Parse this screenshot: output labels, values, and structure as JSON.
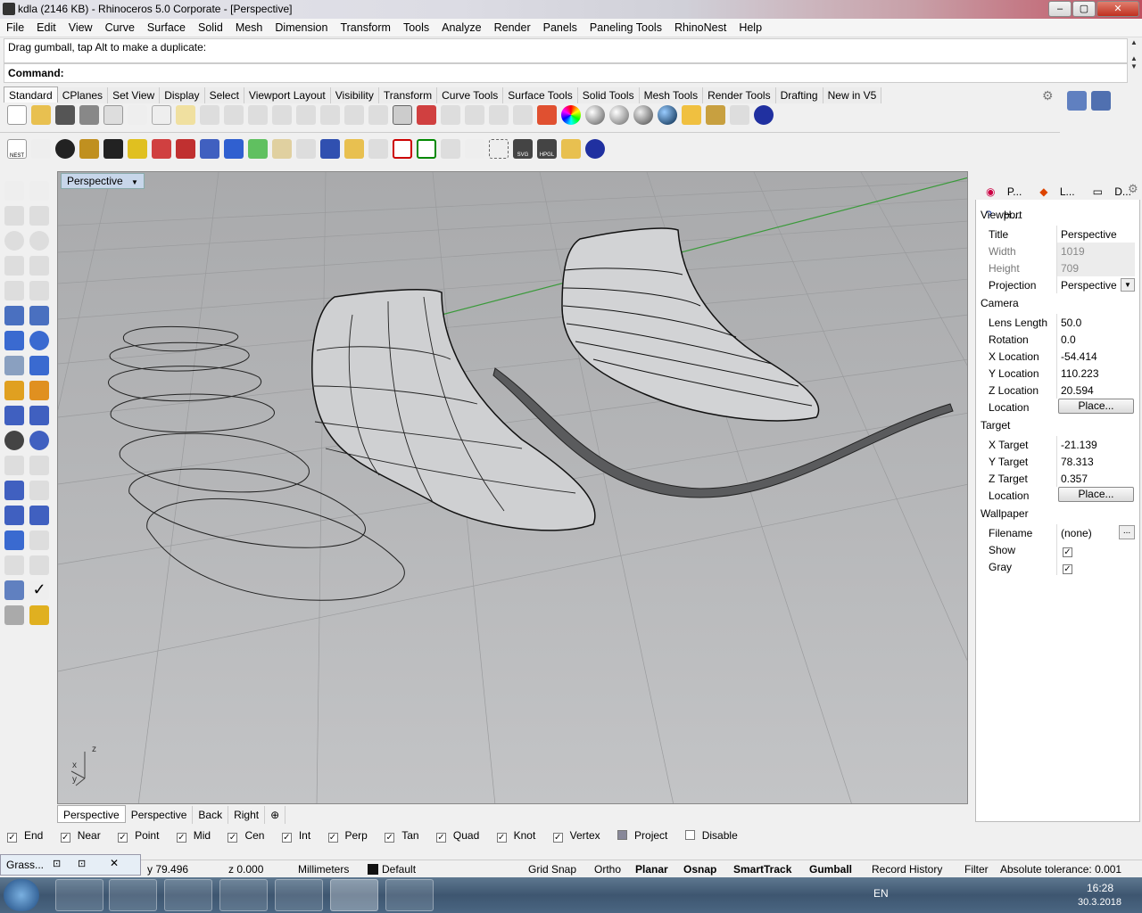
{
  "window": {
    "title": "kdla (2146 KB) - Rhinoceros  5.0 Corporate - [Perspective]"
  },
  "menu": [
    "File",
    "Edit",
    "View",
    "Curve",
    "Surface",
    "Solid",
    "Mesh",
    "Dimension",
    "Transform",
    "Tools",
    "Analyze",
    "Render",
    "Panels",
    "Paneling Tools",
    "RhinoNest",
    "Help"
  ],
  "command": {
    "history": "Drag gumball, tap Alt to make a duplicate:",
    "prompt": "Command:"
  },
  "toolbar_tabs": [
    "Standard",
    "CPlanes",
    "Set View",
    "Display",
    "Select",
    "Viewport Layout",
    "Visibility",
    "Transform",
    "Curve Tools",
    "Surface Tools",
    "Solid Tools",
    "Mesh Tools",
    "Render Tools",
    "Drafting",
    "New in V5"
  ],
  "toolbar_icons": {
    "nest_label": "NEST",
    "svg_label": "SVG",
    "hpgl_label": "HPGL"
  },
  "viewport": {
    "title": "Perspective",
    "axis_x": "x",
    "axis_y": "y",
    "axis_z": "z"
  },
  "viewport_tabs": [
    "Perspective",
    "Perspective",
    "Back",
    "Right"
  ],
  "osnaps": [
    {
      "label": "End",
      "checked": true
    },
    {
      "label": "Near",
      "checked": true
    },
    {
      "label": "Point",
      "checked": true
    },
    {
      "label": "Mid",
      "checked": true
    },
    {
      "label": "Cen",
      "checked": true
    },
    {
      "label": "Int",
      "checked": true
    },
    {
      "label": "Perp",
      "checked": true
    },
    {
      "label": "Tan",
      "checked": true
    },
    {
      "label": "Quad",
      "checked": true
    },
    {
      "label": "Knot",
      "checked": true
    },
    {
      "label": "Vertex",
      "checked": true
    },
    {
      "label": "Project",
      "checked": false
    },
    {
      "label": "Disable",
      "checked": false
    }
  ],
  "status": {
    "y": "y 79.496",
    "z": "z 0.000",
    "units": "Millimeters",
    "layer": "Default",
    "grid_snap": "Grid Snap",
    "ortho": "Ortho",
    "planar": "Planar",
    "osnap": "Osnap",
    "smarttrack": "SmartTrack",
    "gumball": "Gumball",
    "record_history": "Record History",
    "filter": "Filter",
    "tolerance": "Absolute tolerance: 0.001"
  },
  "grasshopper": {
    "label": "Grass..."
  },
  "panel": {
    "tabs": [
      "P...",
      "L...",
      "D...",
      "H..."
    ],
    "sections": {
      "viewport": "Viewport",
      "camera": "Camera",
      "target": "Target",
      "wallpaper": "Wallpaper"
    },
    "viewport_rows": [
      {
        "k": "Title",
        "v": "Perspective"
      },
      {
        "k": "Width",
        "v": "1019"
      },
      {
        "k": "Height",
        "v": "709"
      },
      {
        "k": "Projection",
        "v": "Perspective"
      }
    ],
    "camera_rows": [
      {
        "k": "Lens Length",
        "v": "50.0"
      },
      {
        "k": "Rotation",
        "v": "0.0"
      },
      {
        "k": "X Location",
        "v": "-54.414"
      },
      {
        "k": "Y Location",
        "v": "110.223"
      },
      {
        "k": "Z Location",
        "v": "20.594"
      },
      {
        "k": "Location",
        "v": "Place..."
      }
    ],
    "target_rows": [
      {
        "k": "X Target",
        "v": "-21.139"
      },
      {
        "k": "Y Target",
        "v": "78.313"
      },
      {
        "k": "Z Target",
        "v": "0.357"
      },
      {
        "k": "Location",
        "v": "Place..."
      }
    ],
    "wallpaper_rows": [
      {
        "k": "Filename",
        "v": "(none)"
      },
      {
        "k": "Show",
        "v": "✓"
      },
      {
        "k": "Gray",
        "v": "✓"
      }
    ],
    "browse_label": "..."
  },
  "taskbar": {
    "lang": "EN",
    "time": "16:28",
    "date": "30.3.2018"
  }
}
